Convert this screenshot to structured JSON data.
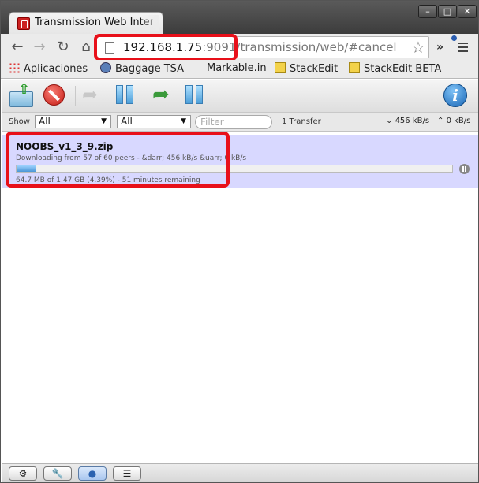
{
  "browser": {
    "tab_title": "Transmission Web Interface",
    "url_host": "192.168.1.75",
    "url_rest": ":9091/transmission/web/#cancel",
    "ext_more": "»",
    "bookmarks": [
      "Aplicaciones",
      "Baggage TSA",
      "Markable.in",
      "StackEdit",
      "StackEdit BETA"
    ],
    "window_buttons": {
      "minimize": "–",
      "maximize": "□",
      "close": "✕"
    }
  },
  "app": {
    "toolbar_icons": [
      "open-icon",
      "remove-icon",
      "resume-icon",
      "pause-icon",
      "resume-all-icon",
      "pause-all-icon",
      "info-icon"
    ],
    "filter": {
      "show_label": "Show",
      "state_value": "All",
      "tracker_value": "All",
      "placeholder": "Filter",
      "transfer_count": "1 Transfer",
      "download_speed": "456 kB/s",
      "upload_speed": "0 kB/s"
    },
    "torrent": {
      "name": "NOOBS_v1_3_9.zip",
      "peer_details": "Downloading from 57 of 60 peers - &darr; 456 kB/s &uarr; 0 kB/s",
      "progress_percent": 4.39,
      "progress_details": "64.7 MB of 1.47 GB (4.39%) - 51 minutes remaining"
    },
    "footer_icons": [
      "gear-icon",
      "wrench-icon",
      "turtle-icon",
      "compact-view-icon"
    ]
  },
  "colors": {
    "highlight_outline": "#e8101a",
    "selected_row": "#d8d8ff",
    "progress_fill": "#4a96d6"
  }
}
